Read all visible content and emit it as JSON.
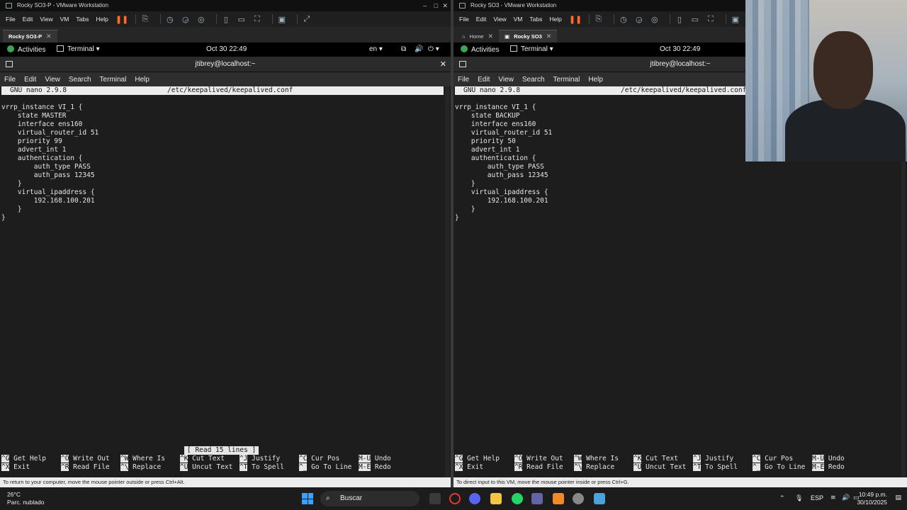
{
  "left_vm": {
    "window_title": "Rocky SO3-P - VMware Workstation",
    "menu": [
      "File",
      "Edit",
      "View",
      "VM",
      "Tabs",
      "Help"
    ],
    "tabs": [
      {
        "label": "Rocky SO3-P",
        "active": true
      }
    ],
    "status_message": "To return to your computer, move the mouse pointer outside or press Ctrl+Alt."
  },
  "right_vm": {
    "window_title": "Rocky SO3 - VMware Workstation",
    "menu": [
      "File",
      "Edit",
      "View",
      "VM",
      "Tabs",
      "Help"
    ],
    "tabs": [
      {
        "label": "Home",
        "active": false
      },
      {
        "label": "Rocky SO3",
        "active": true
      }
    ],
    "status_message": "To direct input to this VM, move the mouse pointer inside or press Ctrl+G."
  },
  "gnome": {
    "activities": "Activities",
    "app_menu": "Terminal",
    "datetime": "Oct 30  22:49",
    "lang": "en"
  },
  "terminal": {
    "title": "jtibrey@localhost:~",
    "menu": [
      "File",
      "Edit",
      "View",
      "Search",
      "Terminal",
      "Help"
    ],
    "nano_version": "GNU nano 2.9.8",
    "file_path": "/etc/keepalived/keepalived.conf"
  },
  "left_code": [
    "vrrp_instance VI_1 {",
    "    state MASTER",
    "    interface ens160",
    "    virtual_router_id 51",
    "    priority 99",
    "    advert_int 1",
    "    authentication {",
    "        auth_type PASS",
    "        auth_pass 12345",
    "    }",
    "    virtual_ipaddress {",
    "        192.168.100.201",
    "    }",
    "}"
  ],
  "right_code": [
    "vrrp_instance VI_1 {",
    "    state BACKUP",
    "    interface ens160",
    "    virtual_router_id 51",
    "    priority 50",
    "    advert_int 1",
    "    authentication {",
    "        auth_type PASS",
    "        auth_pass 12345",
    "    }",
    "    virtual_ipaddress {",
    "        192.168.100.201",
    "    }",
    "}"
  ],
  "nano_status": "[ Read 15 lines ]",
  "shortcuts_row1": [
    {
      "key": "^G",
      "label": "Get Help"
    },
    {
      "key": "^O",
      "label": "Write Out"
    },
    {
      "key": "^W",
      "label": "Where Is"
    },
    {
      "key": "^K",
      "label": "Cut Text"
    },
    {
      "key": "^J",
      "label": "Justify"
    },
    {
      "key": "^C",
      "label": "Cur Pos"
    },
    {
      "key": "M-U",
      "label": "Undo"
    }
  ],
  "shortcuts_row2": [
    {
      "key": "^X",
      "label": "Exit"
    },
    {
      "key": "^R",
      "label": "Read File"
    },
    {
      "key": "^\\",
      "label": "Replace"
    },
    {
      "key": "^U",
      "label": "Uncut Text"
    },
    {
      "key": "^T",
      "label": "To Spell"
    },
    {
      "key": "^_",
      "label": "Go To Line"
    },
    {
      "key": "M-E",
      "label": "Redo"
    }
  ],
  "taskbar": {
    "temp": "26°C",
    "weather": "Parc. nublado",
    "search_placeholder": "Buscar",
    "lang": "ESP",
    "time": "10:49 p.m.",
    "date": "30/10/2025"
  }
}
